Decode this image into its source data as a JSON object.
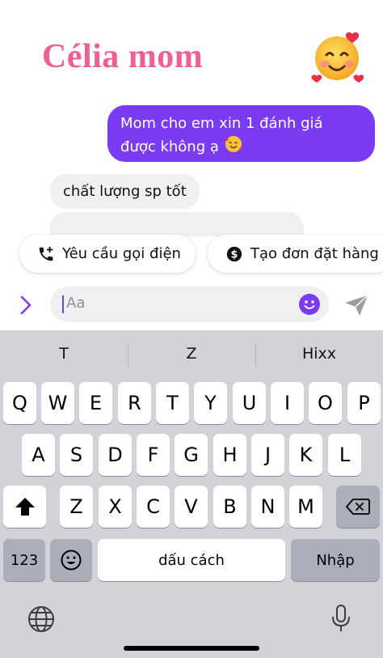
{
  "overlay": {
    "title": "Célia mom",
    "emoji": "smiling-face-with-hearts"
  },
  "chat": {
    "outgoing_text": "Mom cho em xin 1 đánh giá được không ạ",
    "incoming_text": "chất lượng sp tốt"
  },
  "quick_replies": {
    "call_label": "Yêu cầu gọi điện",
    "order_label": "Tạo đơn đặt hàng"
  },
  "composer": {
    "placeholder": "Aa",
    "accent": "#7b3cf1"
  },
  "keyboard": {
    "suggestions": [
      "T",
      "Z",
      "Hixx"
    ],
    "row1": [
      "Q",
      "W",
      "E",
      "R",
      "T",
      "Y",
      "U",
      "I",
      "O",
      "P"
    ],
    "row2": [
      "A",
      "S",
      "D",
      "F",
      "G",
      "H",
      "J",
      "K",
      "L"
    ],
    "row3": [
      "Z",
      "X",
      "C",
      "V",
      "B",
      "N",
      "M"
    ],
    "numbers_label": "123",
    "space_label": "dấu cách",
    "return_label": "Nhập"
  }
}
